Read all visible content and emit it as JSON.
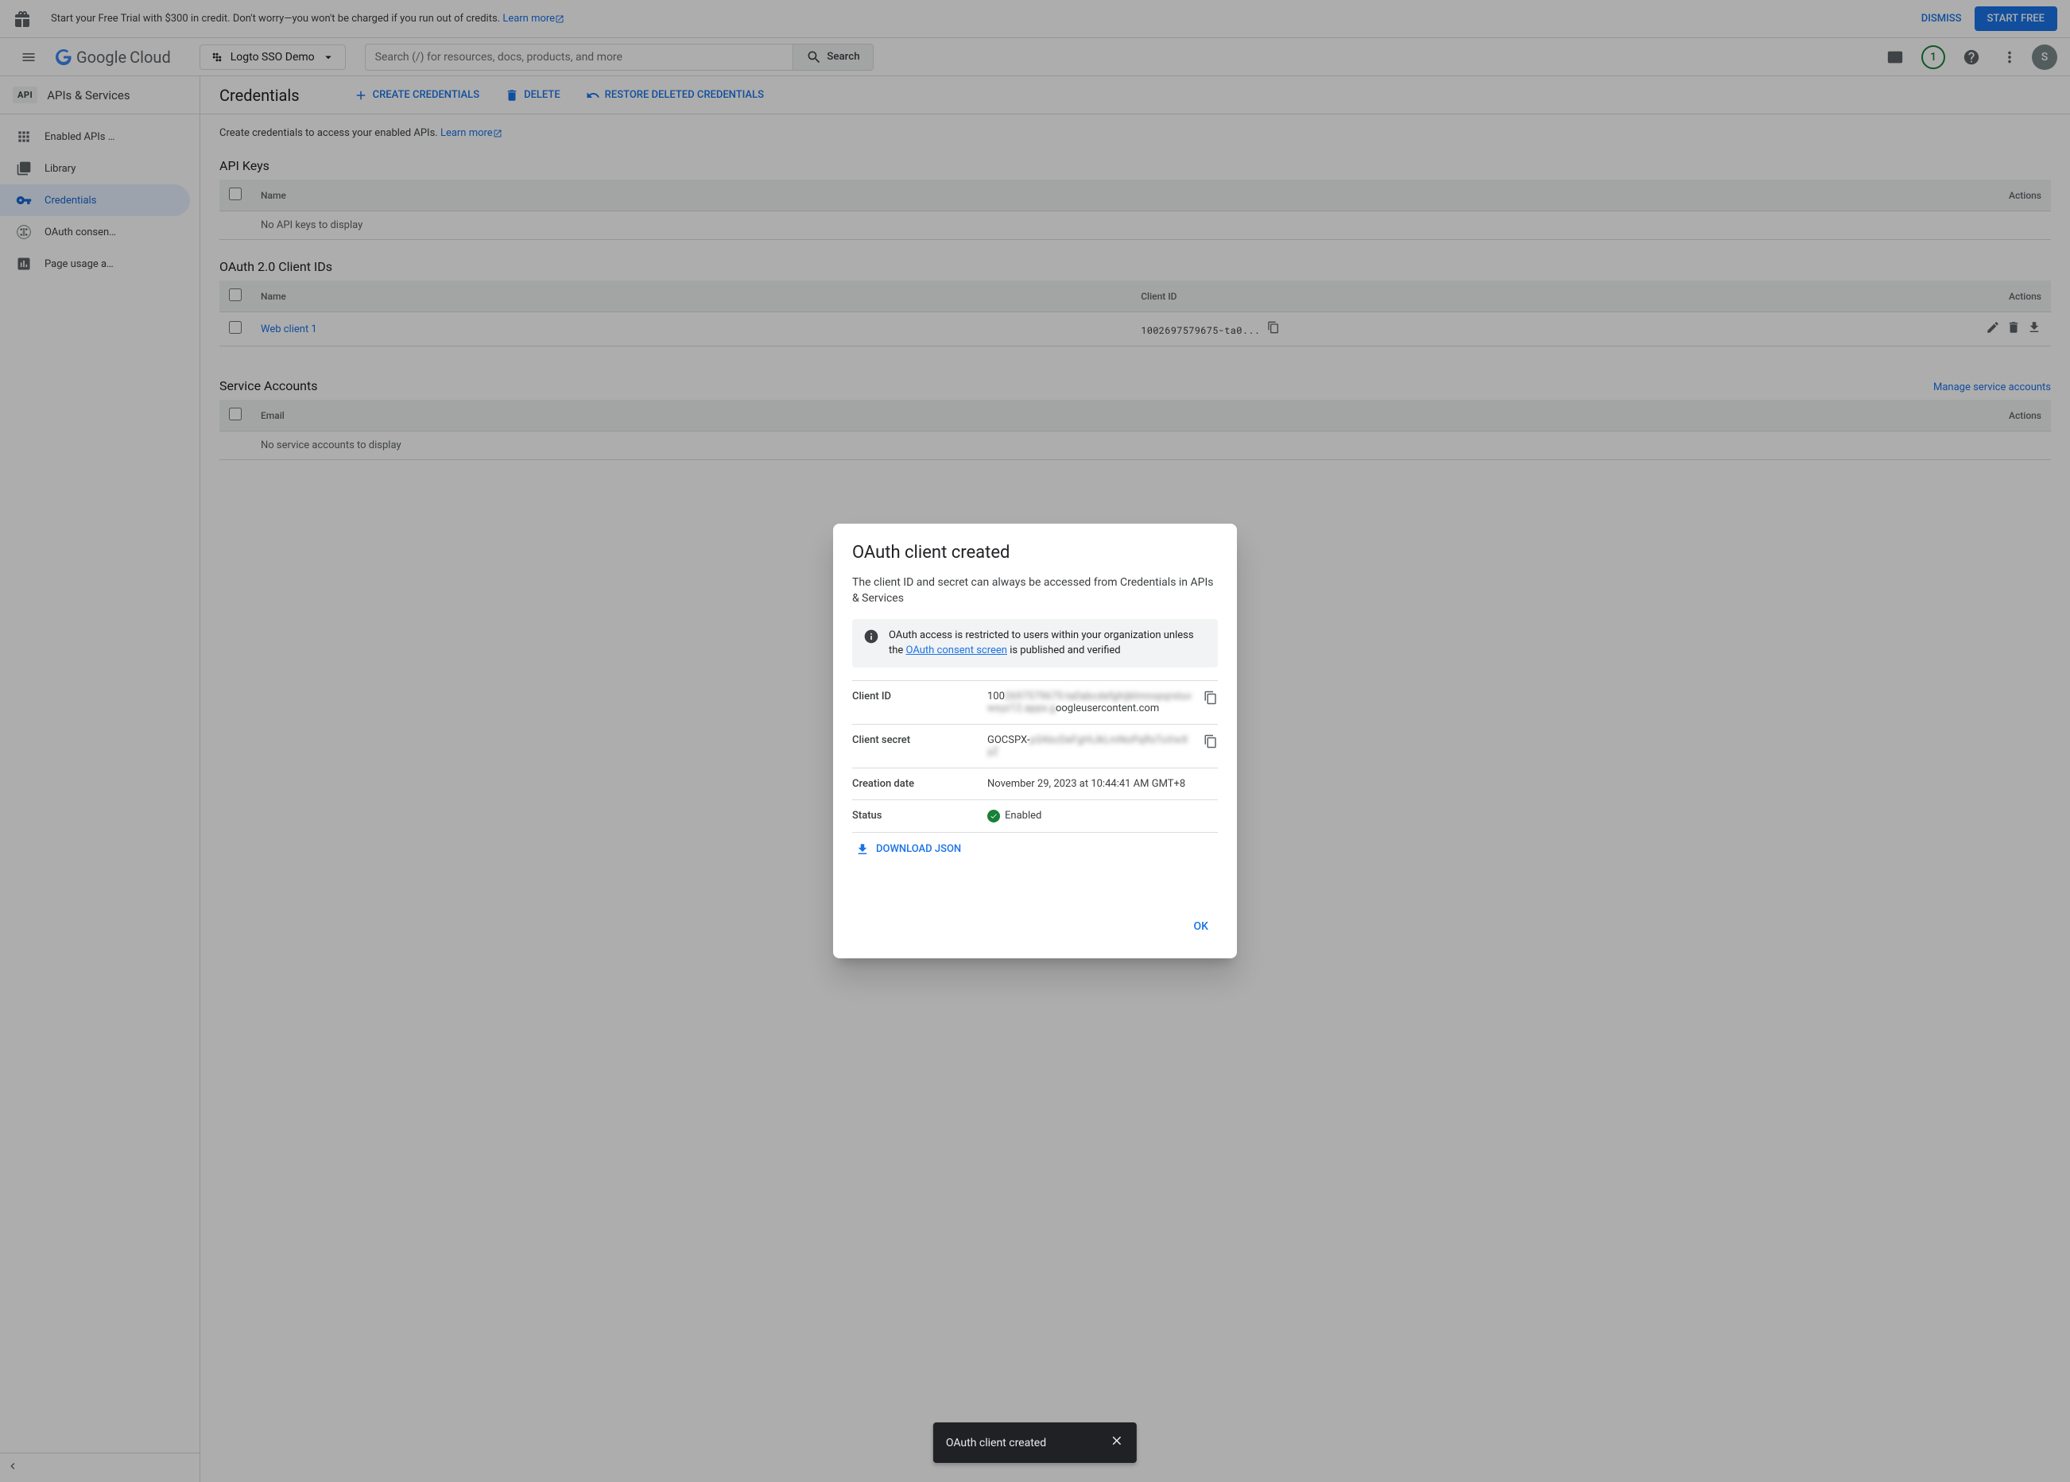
{
  "trial": {
    "message_prefix": "Start your Free Trial with $300 in credit. Don't worry—you won't be charged if you run out of credits. ",
    "learn_more": "Learn more",
    "dismiss": "DISMISS",
    "start_free": "START FREE"
  },
  "header": {
    "logo_google": "Google",
    "logo_cloud": "Cloud",
    "project_name": "Logto SSO Demo",
    "search_placeholder": "Search (/) for resources, docs, products, and more",
    "search_label": "Search",
    "badge_count": "1",
    "avatar_initial": "S"
  },
  "sidebar": {
    "api_badge": "API",
    "title": "APIs & Services",
    "items": [
      {
        "label": "Enabled APIs …",
        "icon": "enabled-apis-icon"
      },
      {
        "label": "Library",
        "icon": "library-icon"
      },
      {
        "label": "Credentials",
        "icon": "key-icon"
      },
      {
        "label": "OAuth consen…",
        "icon": "consent-icon"
      },
      {
        "label": "Page usage a…",
        "icon": "agreements-icon"
      }
    ]
  },
  "page": {
    "title": "Credentials",
    "create_btn": "CREATE CREDENTIALS",
    "delete_btn": "DELETE",
    "restore_btn": "RESTORE DELETED CREDENTIALS",
    "intro_prefix": "Create credentials to access your enabled APIs. ",
    "intro_link": "Learn more"
  },
  "api_keys": {
    "heading": "API Keys",
    "cols": {
      "name": "Name",
      "actions": "Actions"
    },
    "empty": "No API keys to display"
  },
  "oauth_clients": {
    "heading": "OAuth 2.0 Client IDs",
    "cols": {
      "name": "Name",
      "client_id": "Client ID",
      "actions": "Actions"
    },
    "rows": [
      {
        "name": "Web client 1",
        "client_id": "1002697579675-ta0..."
      }
    ]
  },
  "service_accounts": {
    "heading": "Service Accounts",
    "manage_link": "Manage service accounts",
    "cols": {
      "email": "Email",
      "actions": "Actions"
    },
    "empty": "No service accounts to display"
  },
  "modal": {
    "title": "OAuth client created",
    "desc": "The client ID and secret can always be accessed from Credentials in APIs & Services",
    "info_prefix": "OAuth access is restricted to users within your organization unless the ",
    "info_link": "OAuth consent screen",
    "info_suffix": " is published and verified",
    "client_id_label": "Client ID",
    "client_id_visible_prefix": "100",
    "client_id_obscured": "2697579675-ta0abcdefghijklmnopqrstuvwxyz12.apps.g",
    "client_id_visible_suffix": "oogleusercontent.com",
    "client_secret_label": "Client secret",
    "client_secret_prefix": "GOCSPX-",
    "client_secret_obscured": "p3AbcDeFgHiJkLmNoPqRsTuVwXyZ",
    "creation_date_label": "Creation date",
    "creation_date_value": "November 29, 2023 at 10:44:41 AM GMT+8",
    "status_label": "Status",
    "status_value": "Enabled",
    "download_json": "DOWNLOAD JSON",
    "ok": "OK"
  },
  "toast": {
    "message": "OAuth client created"
  }
}
